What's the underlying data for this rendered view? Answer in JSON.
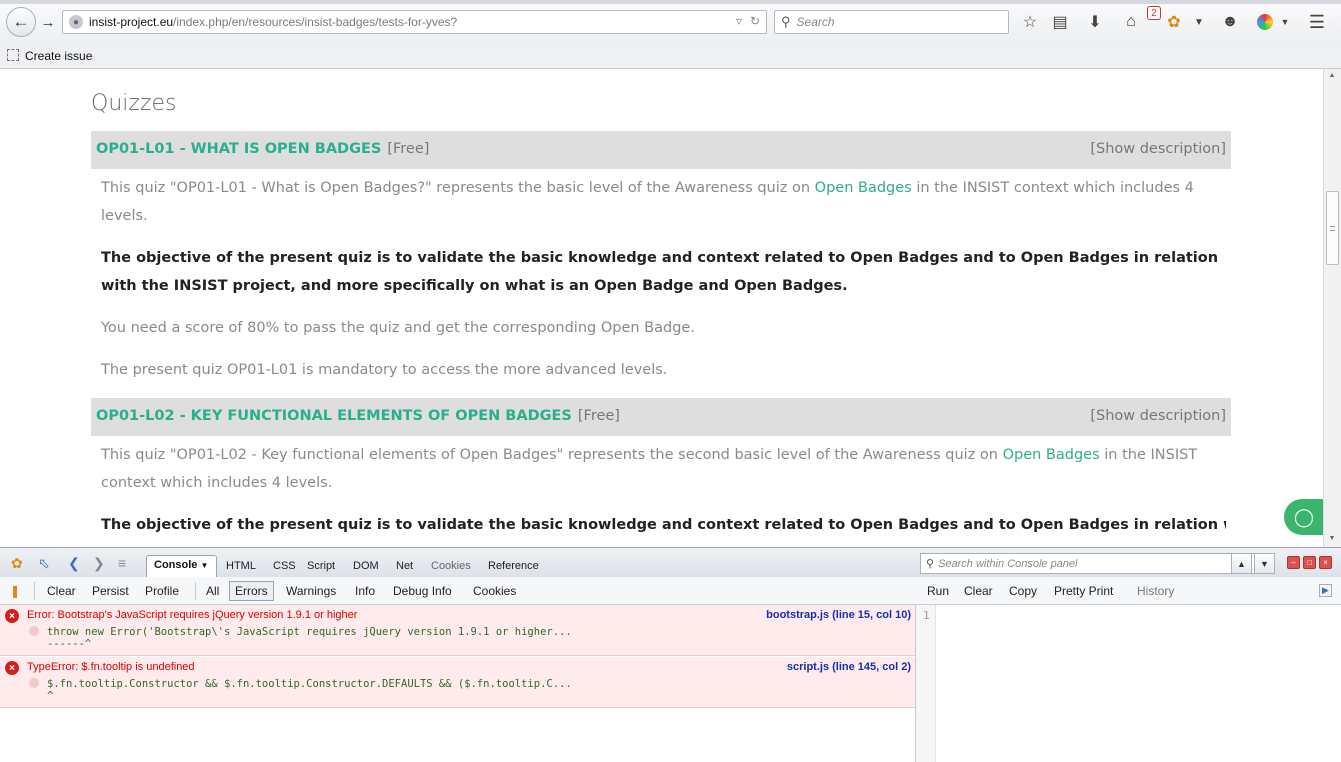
{
  "browser": {
    "url_host": "insist-project.eu",
    "url_path": "/index.php/en/resources/insist-badges/tests-for-yves?",
    "search_placeholder": "Search",
    "notification_count": "2",
    "bookmark_label": "Create issue"
  },
  "page": {
    "title": "Quizzes",
    "quizzes": [
      {
        "title": "OP01-L01 - WHAT IS OPEN BADGES",
        "price": "[Free]",
        "show_description": "[Show description]",
        "intro_before": "This quiz \"OP01-L01 - What is Open Badges?\" represents the basic level of the Awareness quiz on ",
        "intro_link": "Open Badges",
        "intro_after": " in the INSIST context which includes 4 levels.",
        "objective": "The objective of the present quiz is to validate the basic knowledge and context related to Open Badges and to Open Badges in relation with the INSIST project, and more specifically on what is an Open Badge and Open Badges.",
        "score": "You need a score of 80% to pass the quiz and get the corresponding Open Badge.",
        "mandatory": "The present quiz OP01-L01 is mandatory to access the more advanced levels."
      },
      {
        "title": "OP01-L02 - KEY FUNCTIONAL ELEMENTS OF OPEN BADGES",
        "price": "[Free]",
        "show_description": "[Show description]",
        "intro_before": "This quiz \"OP01-L02 - Key functional elements of Open Badges\" represents the second basic level of the Awareness quiz on ",
        "intro_link": "Open Badges",
        "intro_after": " in the INSIST context which includes 4 levels.",
        "objective": "The objective of the present quiz is to validate the basic knowledge and context related to Open Badges and to Open Badges in relation with the"
      }
    ]
  },
  "firebug": {
    "tabs": [
      "Console",
      "HTML",
      "CSS",
      "Script",
      "DOM",
      "Net",
      "Cookies",
      "Reference"
    ],
    "search_placeholder": "Search within Console panel",
    "toolbar_left": [
      "Clear",
      "Persist",
      "Profile",
      "All",
      "Errors",
      "Warnings",
      "Info",
      "Debug Info",
      "Cookies"
    ],
    "toolbar_right": [
      "Run",
      "Clear",
      "Copy",
      "Pretty Print",
      "History"
    ],
    "line_number": "1",
    "errors": [
      {
        "message": "Error: Bootstrap's JavaScript requires jQuery version 1.9.1 or higher",
        "source": "bootstrap.js (line 15, col 10)",
        "code": "throw new Error('Bootstrap\\'s JavaScript requires jQuery version 1.9.1 or higher...",
        "caret": "------^"
      },
      {
        "message": "TypeError: $.fn.tooltip is undefined",
        "source": "script.js (line 145, col 2)",
        "code": "$.fn.tooltip.Constructor && $.fn.tooltip.Constructor.DEFAULTS && ($.fn.tooltip.C...",
        "caret": "^"
      }
    ]
  }
}
